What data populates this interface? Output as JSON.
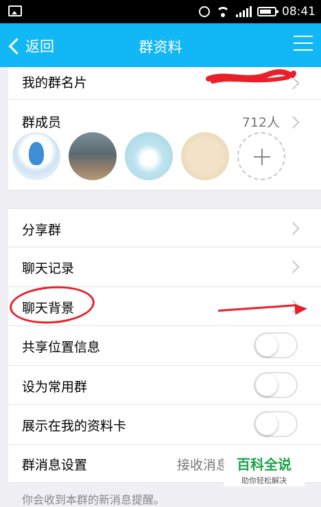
{
  "status_bar": {
    "time": "08:41"
  },
  "nav": {
    "back_label": "返回",
    "title": "群资料"
  },
  "sections": {
    "my_card": {
      "label": "我的群名片"
    },
    "members": {
      "label": "群成员",
      "count": "712人"
    },
    "share": {
      "label": "分享群"
    },
    "chat_history": {
      "label": "聊天记录"
    },
    "chat_background": {
      "label": "聊天背景"
    },
    "share_location": {
      "label": "共享位置信息",
      "enabled": false
    },
    "set_common": {
      "label": "设为常用群",
      "enabled": false
    },
    "show_on_card": {
      "label": "展示在我的资料卡",
      "enabled": false
    },
    "message_settings": {
      "label": "群消息设置",
      "value": "接收消息"
    }
  },
  "footer_note": "你会收到本群的新消息提醒。",
  "watermark": {
    "title": "百科全说",
    "subtitle": "助你轻松解决"
  },
  "colors": {
    "nav_bg": "#12b7f5",
    "annotation_red": "#e8202a",
    "watermark_green": "#1aa34a"
  }
}
